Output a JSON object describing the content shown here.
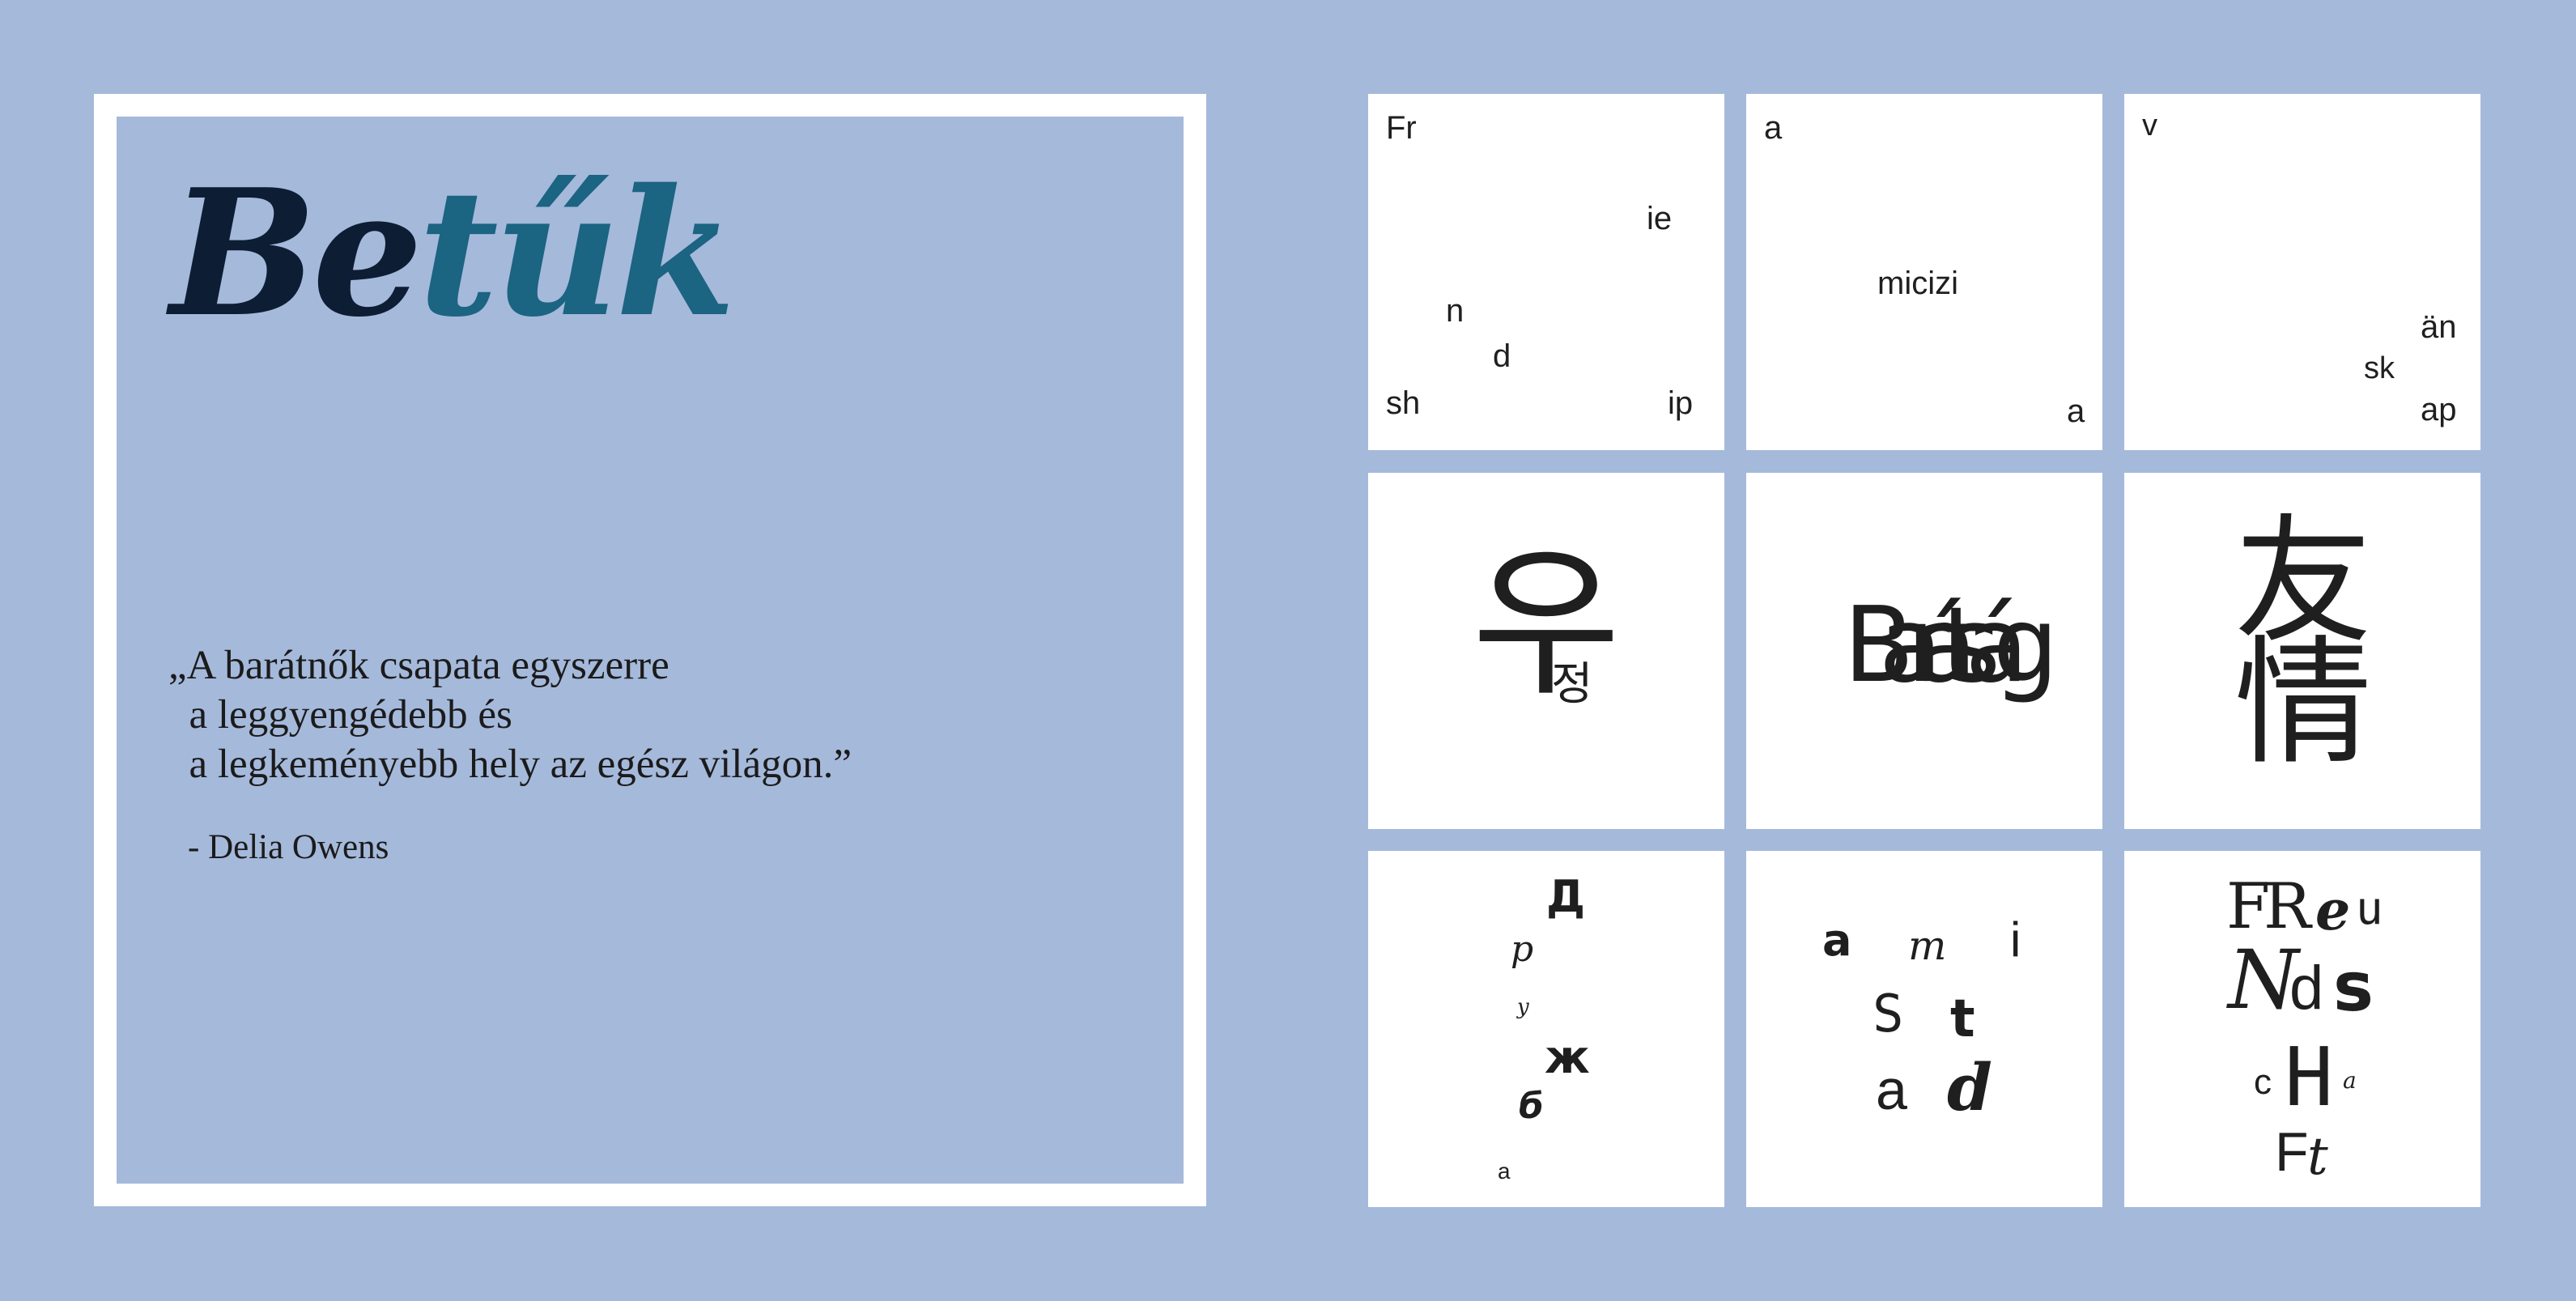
{
  "title": {
    "part1": "Be",
    "part2": "tűk"
  },
  "quote": {
    "lines": [
      "„A barátnők csapata egyszerre",
      "  a leggyengédebb és",
      "  a legkeményebb hely az egész világon.”"
    ],
    "author": "- Delia Owens"
  },
  "tiles": {
    "t1": [
      "Fr",
      "ie",
      "n",
      "d",
      "sh",
      "ip"
    ],
    "t2": [
      "a",
      "micizi",
      "a"
    ],
    "t3": [
      "v",
      "än",
      "sk",
      "ap"
    ],
    "t4": [
      "우",
      "정"
    ],
    "t5": [
      "Barátság"
    ],
    "t6": [
      "友",
      "情"
    ],
    "t7": [
      "Д",
      "р",
      "у",
      "ж",
      "б",
      "а"
    ],
    "t8": [
      "a",
      "m",
      "i",
      "S",
      "t",
      "a",
      "d"
    ],
    "t9": [
      "F",
      "R",
      "e",
      "u",
      "N",
      "d",
      "s",
      "c",
      "H",
      "a",
      "F",
      "t"
    ]
  },
  "colors": {
    "background": "#a5b9db",
    "tile": "#ffffff",
    "title_dark": "#0d1d33",
    "title_teal": "#1b6482"
  }
}
